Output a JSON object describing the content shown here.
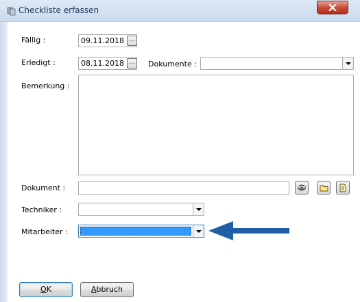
{
  "window": {
    "title": "Checkliste erfassen",
    "close_symbol": "x"
  },
  "fields": {
    "faellig": {
      "label": "Fällig :",
      "value": "09.11.2018"
    },
    "erledigt": {
      "label": "Erledigt :",
      "value": "08.11.2018"
    },
    "dokumente": {
      "label": "Dokumente :",
      "value": ""
    },
    "bemerkung": {
      "label": "Bemerkung :",
      "value": ""
    },
    "dokument": {
      "label": "Dokument :",
      "value": ""
    },
    "techniker": {
      "label": "Techniker :",
      "value": ""
    },
    "mitarbeiter": {
      "label": "Mitarbeiter :",
      "value": ""
    }
  },
  "buttons": {
    "ok_prefix": "O",
    "ok_rest": "K",
    "ok_accel": "O",
    "cancel_accel": "A",
    "cancel_rest": "bbruch",
    "ellipsis": "…"
  },
  "colors": {
    "selection": "#3399ff",
    "arrow": "#1f5fa8",
    "close_red": "#c74f3a"
  },
  "icons": [
    "checklist-icon",
    "scanner-icon",
    "folder-icon",
    "document-icon",
    "calendar-ellipsis-icon",
    "dropdown-arrow-icon",
    "pointer-arrow"
  ]
}
